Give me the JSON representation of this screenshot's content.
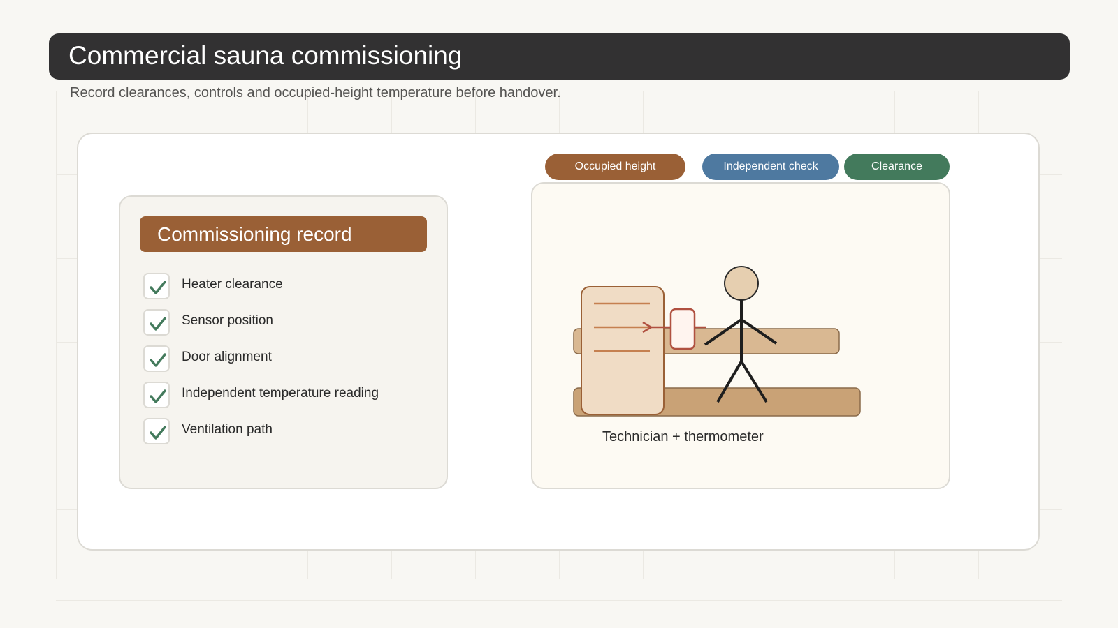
{
  "header": {
    "title": "Commercial sauna commissioning",
    "subtitle": "Record clearances, controls and occupied-height temperature before handover."
  },
  "record": {
    "title": "Commissioning record",
    "items": [
      {
        "label": "Heater clearance",
        "checked": true
      },
      {
        "label": "Sensor position",
        "checked": true
      },
      {
        "label": "Door alignment",
        "checked": true
      },
      {
        "label": "Independent temperature reading",
        "checked": true
      },
      {
        "label": "Ventilation path",
        "checked": true
      }
    ]
  },
  "tags": [
    {
      "label": "Occupied height",
      "color": "#9a6036"
    },
    {
      "label": "Independent check",
      "color": "#4e79a0"
    },
    {
      "label": "Clearance",
      "color": "#437a5c"
    }
  ],
  "diagram": {
    "caption": "Technician + thermometer"
  },
  "colors": {
    "brown": "#9a6036",
    "blue": "#4e79a0",
    "green": "#437a5c",
    "dark": "#323132",
    "check": "#437a5c"
  }
}
